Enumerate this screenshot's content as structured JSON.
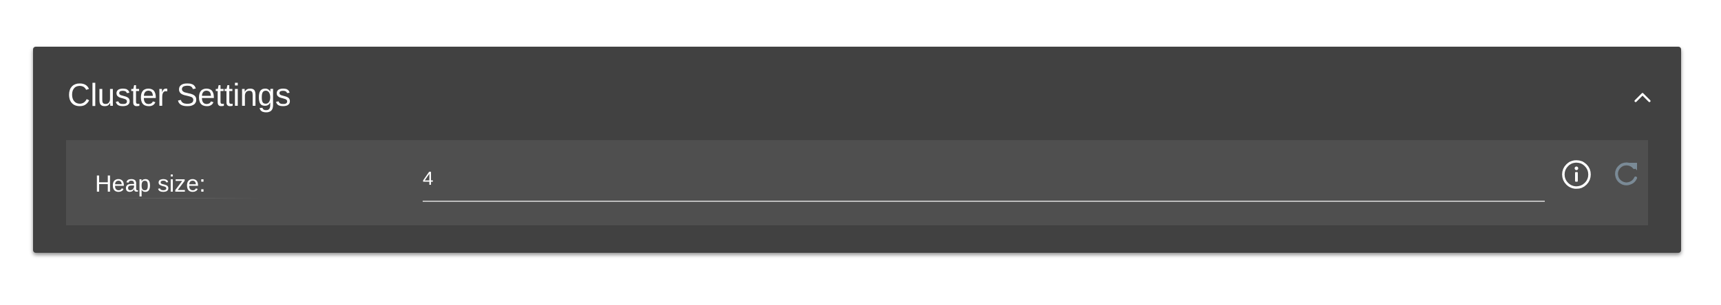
{
  "panel": {
    "title": "Cluster Settings",
    "collapse_icon": "chevron-up-icon"
  },
  "settings": [
    {
      "label": "Heap size:",
      "value": "4",
      "info_icon": "info-icon",
      "reset_icon": "refresh-icon"
    }
  ],
  "colors": {
    "panel_bg": "#414141",
    "row_bg": "#4f4f4f",
    "text": "#ffffff",
    "underline": "#bdbdbd",
    "reset_icon_color": "#7a8a96"
  }
}
